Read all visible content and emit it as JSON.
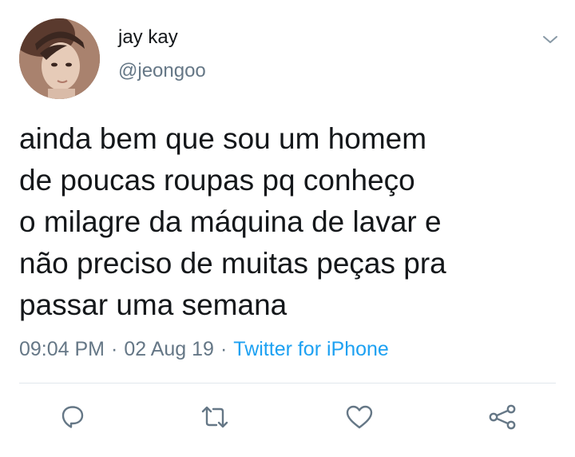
{
  "author": {
    "display_name": "jay kay",
    "handle": "@jeongoo"
  },
  "tweet": {
    "lines": [
      "ainda bem que sou um homem",
      "de poucas roupas pq conheço",
      "o milagre da máquina de lavar e",
      "não preciso de muitas peças pra",
      "passar uma semana"
    ],
    "time": "09:04 PM",
    "date": "02 Aug 19",
    "separator": "·",
    "source": "Twitter for iPhone"
  },
  "actions": {
    "reply_icon": "reply-icon",
    "retweet_icon": "retweet-icon",
    "like_icon": "heart-icon",
    "share_icon": "share-icon"
  },
  "colors": {
    "text": "#14171a",
    "secondary": "#657786",
    "link": "#1da1f2",
    "divider": "#e1e8ed"
  }
}
